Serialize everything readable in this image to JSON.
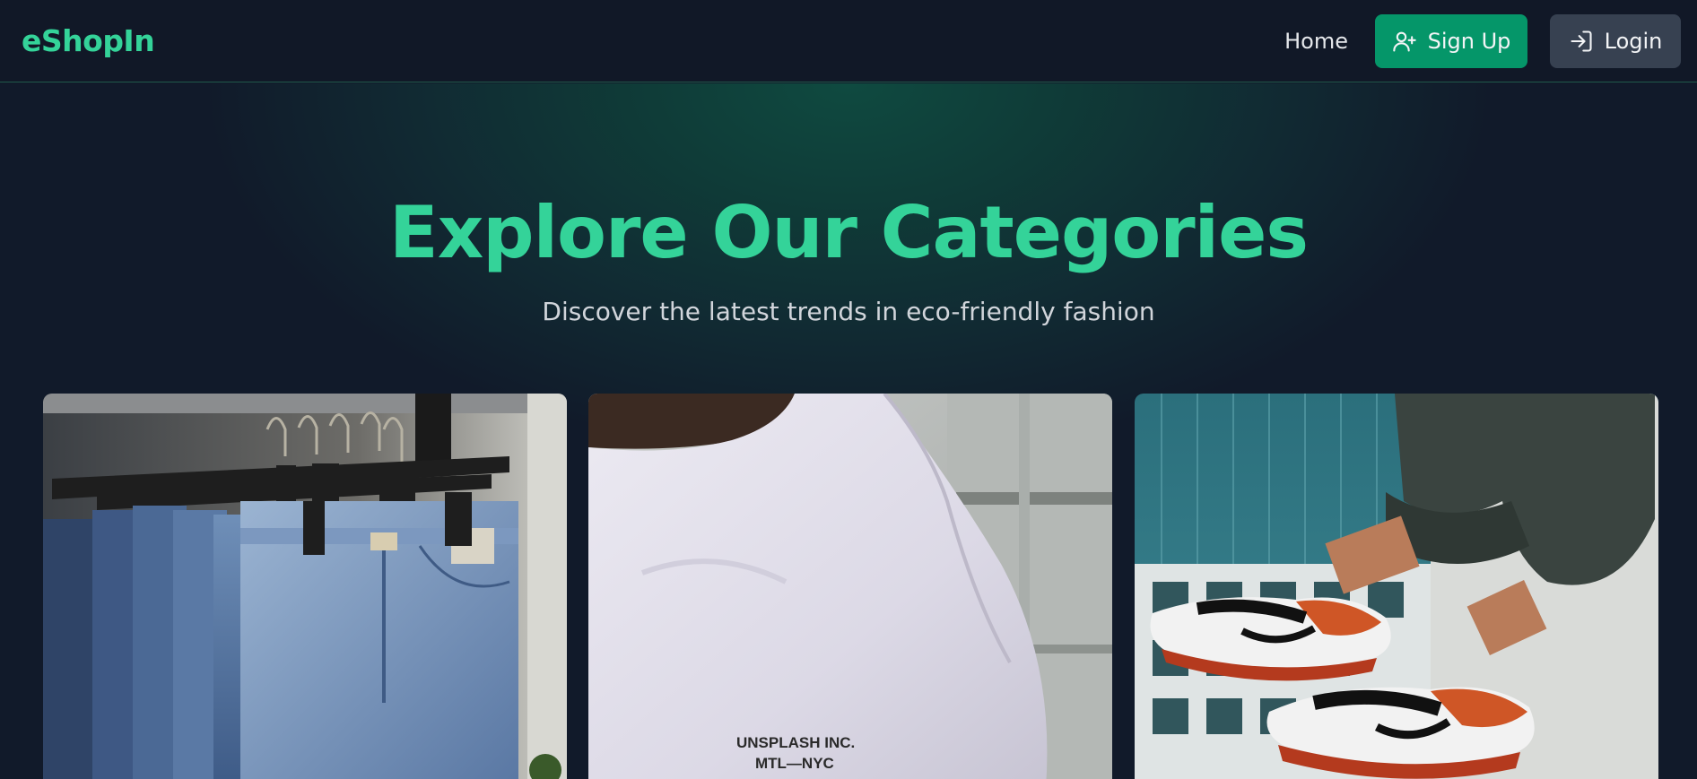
{
  "navbar": {
    "brand": "eShopIn",
    "home_label": "Home",
    "signup_label": "Sign Up",
    "login_label": "Login"
  },
  "hero": {
    "title": "Explore Our Categories",
    "subtitle": "Discover the latest trends in eco-friendly fashion"
  },
  "categories": [
    {
      "image": "jeans-rack-photo"
    },
    {
      "image": "white-tshirt-photo",
      "shirt_print": [
        "UNSPLASH INC.",
        "MTL—NYC"
      ]
    },
    {
      "image": "sneakers-photo"
    }
  ],
  "colors": {
    "accent": "#34d399",
    "signup_bg": "#059669",
    "login_bg": "#374151",
    "nav_bg": "#111827",
    "page_bg": "#111a2a"
  }
}
